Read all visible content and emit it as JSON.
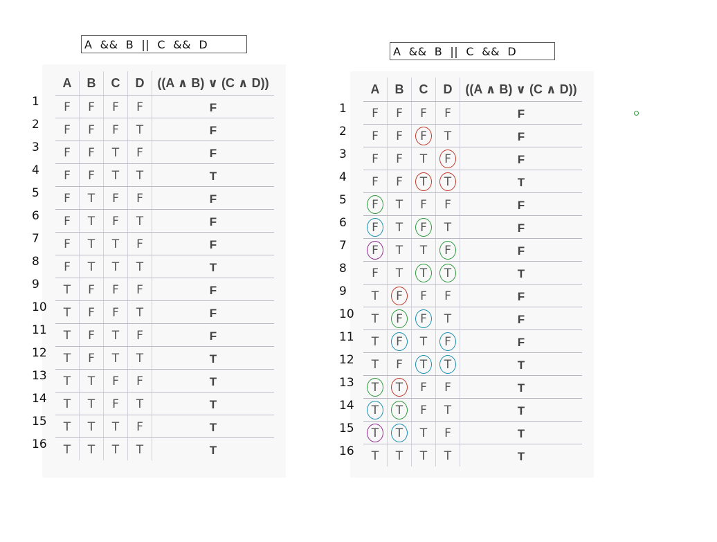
{
  "tables": [
    {
      "expression": "A  &&  B  ||  C  &&  D",
      "headers": [
        "A",
        "B",
        "C",
        "D",
        "((A ∧ B) ∨ (C ∧ D))"
      ],
      "row_numbers": [
        "1",
        "2",
        "3",
        "4",
        "5",
        "6",
        "7",
        "8",
        "9",
        "10",
        "11",
        "12",
        "13",
        "14",
        "15",
        "16"
      ],
      "rows": [
        [
          "F",
          "F",
          "F",
          "F",
          "F"
        ],
        [
          "F",
          "F",
          "F",
          "T",
          "F"
        ],
        [
          "F",
          "F",
          "T",
          "F",
          "F"
        ],
        [
          "F",
          "F",
          "T",
          "T",
          "T"
        ],
        [
          "F",
          "T",
          "F",
          "F",
          "F"
        ],
        [
          "F",
          "T",
          "F",
          "T",
          "F"
        ],
        [
          "F",
          "T",
          "T",
          "F",
          "F"
        ],
        [
          "F",
          "T",
          "T",
          "T",
          "T"
        ],
        [
          "T",
          "F",
          "F",
          "F",
          "F"
        ],
        [
          "T",
          "F",
          "F",
          "T",
          "F"
        ],
        [
          "T",
          "F",
          "T",
          "F",
          "F"
        ],
        [
          "T",
          "F",
          "T",
          "T",
          "T"
        ],
        [
          "T",
          "T",
          "F",
          "F",
          "T"
        ],
        [
          "T",
          "T",
          "F",
          "T",
          "T"
        ],
        [
          "T",
          "T",
          "T",
          "F",
          "T"
        ],
        [
          "T",
          "T",
          "T",
          "T",
          "T"
        ]
      ],
      "circles": []
    },
    {
      "expression": "A  &&  B  ||  C  &&  D",
      "headers": [
        "A",
        "B",
        "C",
        "D",
        "((A ∧ B) ∨ (C ∧ D))"
      ],
      "row_numbers": [
        "1",
        "2",
        "3",
        "4",
        "5",
        "6",
        "7",
        "8",
        "9",
        "10",
        "11",
        "12",
        "13",
        "14",
        "15",
        "16"
      ],
      "rows": [
        [
          "F",
          "F",
          "F",
          "F",
          "F"
        ],
        [
          "F",
          "F",
          "F",
          "T",
          "F"
        ],
        [
          "F",
          "F",
          "T",
          "F",
          "F"
        ],
        [
          "F",
          "F",
          "T",
          "T",
          "T"
        ],
        [
          "F",
          "T",
          "F",
          "F",
          "F"
        ],
        [
          "F",
          "T",
          "F",
          "T",
          "F"
        ],
        [
          "F",
          "T",
          "T",
          "F",
          "F"
        ],
        [
          "F",
          "T",
          "T",
          "T",
          "T"
        ],
        [
          "T",
          "F",
          "F",
          "F",
          "F"
        ],
        [
          "T",
          "F",
          "F",
          "T",
          "F"
        ],
        [
          "T",
          "F",
          "T",
          "F",
          "F"
        ],
        [
          "T",
          "F",
          "T",
          "T",
          "T"
        ],
        [
          "T",
          "T",
          "F",
          "F",
          "T"
        ],
        [
          "T",
          "T",
          "F",
          "T",
          "T"
        ],
        [
          "T",
          "T",
          "T",
          "F",
          "T"
        ],
        [
          "T",
          "T",
          "T",
          "T",
          "T"
        ]
      ],
      "circles": [
        {
          "row": 1,
          "col": 2,
          "color": "#c0392b"
        },
        {
          "row": 2,
          "col": 3,
          "color": "#c0392b"
        },
        {
          "row": 3,
          "col": 2,
          "color": "#c0392b"
        },
        {
          "row": 3,
          "col": 3,
          "color": "#c0392b"
        },
        {
          "row": 4,
          "col": 0,
          "color": "#2e9a3c"
        },
        {
          "row": 5,
          "col": 0,
          "color": "#1a8fb0"
        },
        {
          "row": 5,
          "col": 2,
          "color": "#2e9a3c"
        },
        {
          "row": 6,
          "col": 0,
          "color": "#8e2a8e"
        },
        {
          "row": 6,
          "col": 3,
          "color": "#2e9a3c"
        },
        {
          "row": 7,
          "col": 2,
          "color": "#2e9a3c"
        },
        {
          "row": 7,
          "col": 3,
          "color": "#2e9a3c"
        },
        {
          "row": 8,
          "col": 1,
          "color": "#c0392b"
        },
        {
          "row": 9,
          "col": 1,
          "color": "#2e9a3c"
        },
        {
          "row": 9,
          "col": 2,
          "color": "#1a8fb0"
        },
        {
          "row": 10,
          "col": 1,
          "color": "#1a8fb0"
        },
        {
          "row": 10,
          "col": 3,
          "color": "#1a8fb0"
        },
        {
          "row": 11,
          "col": 2,
          "color": "#1a8fb0"
        },
        {
          "row": 11,
          "col": 3,
          "color": "#1a8fb0"
        },
        {
          "row": 12,
          "col": 0,
          "color": "#2e9a3c"
        },
        {
          "row": 12,
          "col": 1,
          "color": "#c0392b"
        },
        {
          "row": 13,
          "col": 0,
          "color": "#1a8fb0"
        },
        {
          "row": 13,
          "col": 1,
          "color": "#2e9a3c"
        },
        {
          "row": 14,
          "col": 0,
          "color": "#8e2a8e"
        },
        {
          "row": 14,
          "col": 1,
          "color": "#1a8fb0"
        }
      ]
    }
  ]
}
